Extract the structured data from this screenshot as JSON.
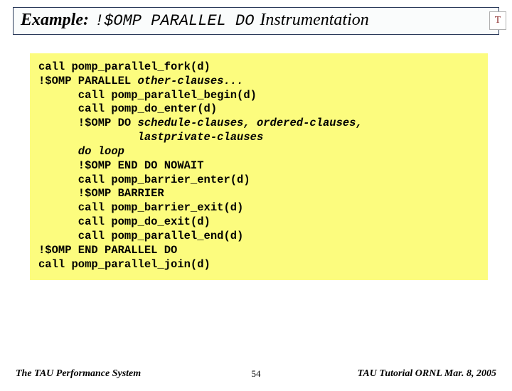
{
  "title": {
    "example": "Example:",
    "code": "!$OMP PARALLEL DO",
    "rest": "Instrumentation"
  },
  "logo": "T",
  "code": {
    "l1": "call pomp_parallel_fork(d)",
    "l2a": "!$OMP PARALLEL ",
    "l2b": "other-clauses...",
    "l3": "      call pomp_parallel_begin(d)",
    "l4": "      call pomp_do_enter(d)",
    "l5a": "      !$OMP DO ",
    "l5b": "schedule-clauses, ordered-clauses,",
    "l6": "               lastprivate-clauses",
    "l7": "      do loop",
    "l8": "      !$OMP END DO NOWAIT",
    "l9": "      call pomp_barrier_enter(d)",
    "l10": "      !$OMP BARRIER",
    "l11": "      call pomp_barrier_exit(d)",
    "l12": "      call pomp_do_exit(d)",
    "l13": "      call pomp_parallel_end(d)",
    "l14": "!$OMP END PARALLEL DO",
    "l15": "call pomp_parallel_join(d)"
  },
  "footer": {
    "left": "The TAU Performance System",
    "center": "54",
    "right": "TAU Tutorial ORNL Mar. 8, 2005"
  }
}
